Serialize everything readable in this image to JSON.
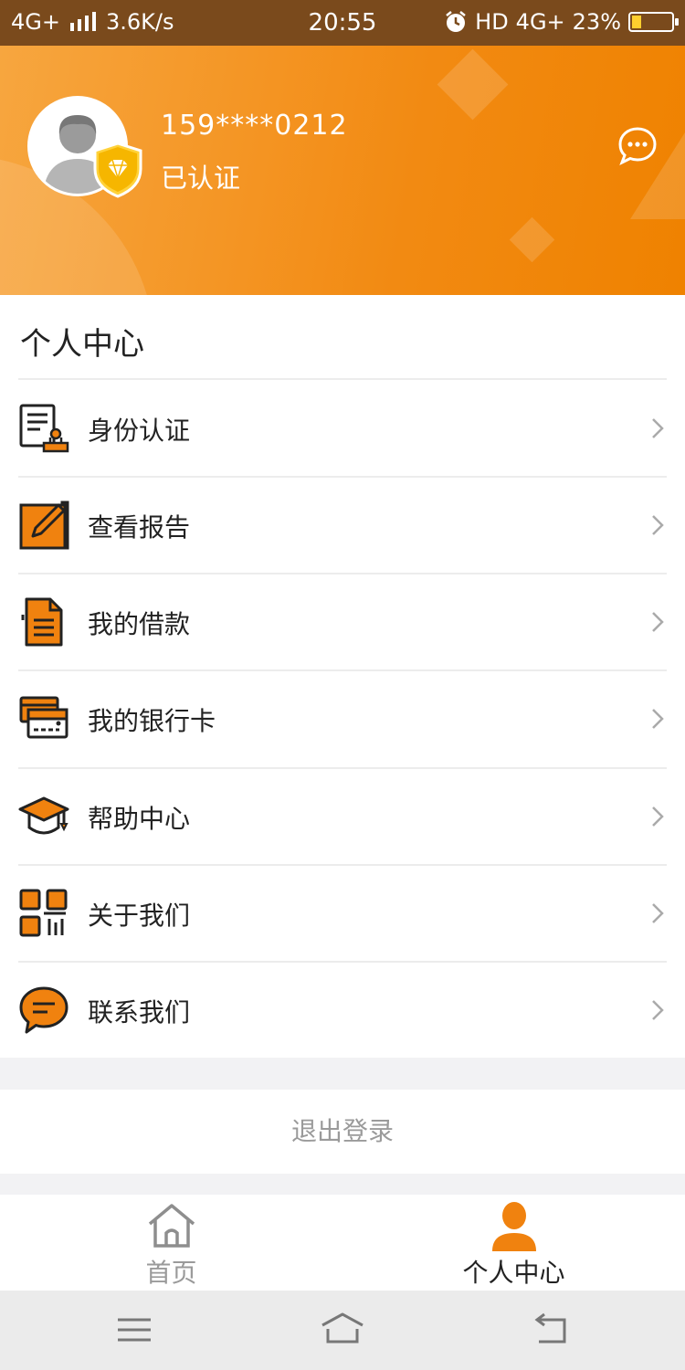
{
  "status_bar": {
    "network": "4G+",
    "speed": "3.6K/s",
    "time": "20:55",
    "hd": "HD",
    "network2": "4G+",
    "battery": "23%",
    "battery_level": 0.23
  },
  "profile": {
    "phone": "159****0212",
    "status": "已认证"
  },
  "section_title": "个人中心",
  "menu": [
    {
      "label": "身份认证",
      "icon": "id-document-icon"
    },
    {
      "label": "查看报告",
      "icon": "edit-report-icon"
    },
    {
      "label": "我的借款",
      "icon": "loan-document-icon"
    },
    {
      "label": "我的银行卡",
      "icon": "bank-card-icon"
    },
    {
      "label": "帮助中心",
      "icon": "graduation-cap-icon"
    },
    {
      "label": "关于我们",
      "icon": "qr-code-icon"
    },
    {
      "label": "联系我们",
      "icon": "chat-bubble-icon"
    }
  ],
  "logout_label": "退出登录",
  "tabs": [
    {
      "label": "首页",
      "icon": "home-icon",
      "active": false
    },
    {
      "label": "个人中心",
      "icon": "person-icon",
      "active": true
    }
  ],
  "colors": {
    "accent": "#f28a12",
    "status_bar": "#7a4a1c",
    "inactive": "#9a9a9a"
  }
}
